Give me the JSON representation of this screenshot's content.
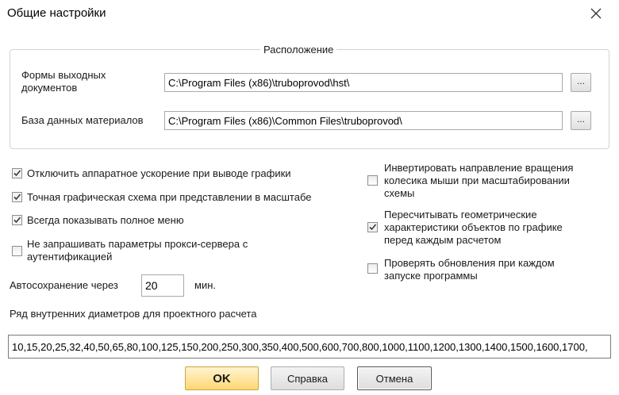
{
  "window": {
    "title": "Общие настройки"
  },
  "location": {
    "legend": "Расположение",
    "output_forms_label_line1": "Формы выходных",
    "output_forms_label_line2": "документов",
    "output_forms_path": "C:\\Program Files (x86)\\truboprovod\\hst\\",
    "materials_db_label": "База данных материалов",
    "materials_db_path": "C:\\Program Files (x86)\\Common Files\\truboprovod\\",
    "browse_label": "..."
  },
  "options_left": [
    {
      "label": "Отключить аппаратное ускорение при выводе графики",
      "checked": true
    },
    {
      "label": "Точная графическая схема при представлении в масштабе",
      "checked": true
    },
    {
      "label": "Всегда показывать полное меню",
      "checked": true
    },
    {
      "label_line1": "Не запрашивать параметры прокси-сервера с",
      "label_line2": "аутентификацией",
      "checked": false
    }
  ],
  "options_right": [
    {
      "label_line1": "Инвертировать направление вращения",
      "label_line2": "колесика мыши при масштабировании",
      "label_line3": "схемы",
      "checked": false
    },
    {
      "label_line1": "Пересчитывать геометрические",
      "label_line2": "характеристики объектов по графике",
      "label_line3": "перед каждым расчетом",
      "checked": true
    },
    {
      "label_line1": "Проверять обновления при каждом",
      "label_line2": "запуске программы",
      "checked": false
    }
  ],
  "autosave": {
    "label": "Автосохранение через",
    "value": "20",
    "unit": "мин."
  },
  "diameters": {
    "label": "Ряд внутренних диаметров для проектного расчета",
    "value": "10,15,20,25,32,40,50,65,80,100,125,150,200,250,300,350,400,500,600,700,800,1000,1100,1200,1300,1400,1500,1600,1700,"
  },
  "buttons": {
    "ok": "OK",
    "help": "Справка",
    "cancel": "Отмена"
  },
  "colors": {
    "ok_button": "#ffd774",
    "checkmark": "#3a3a3a"
  }
}
